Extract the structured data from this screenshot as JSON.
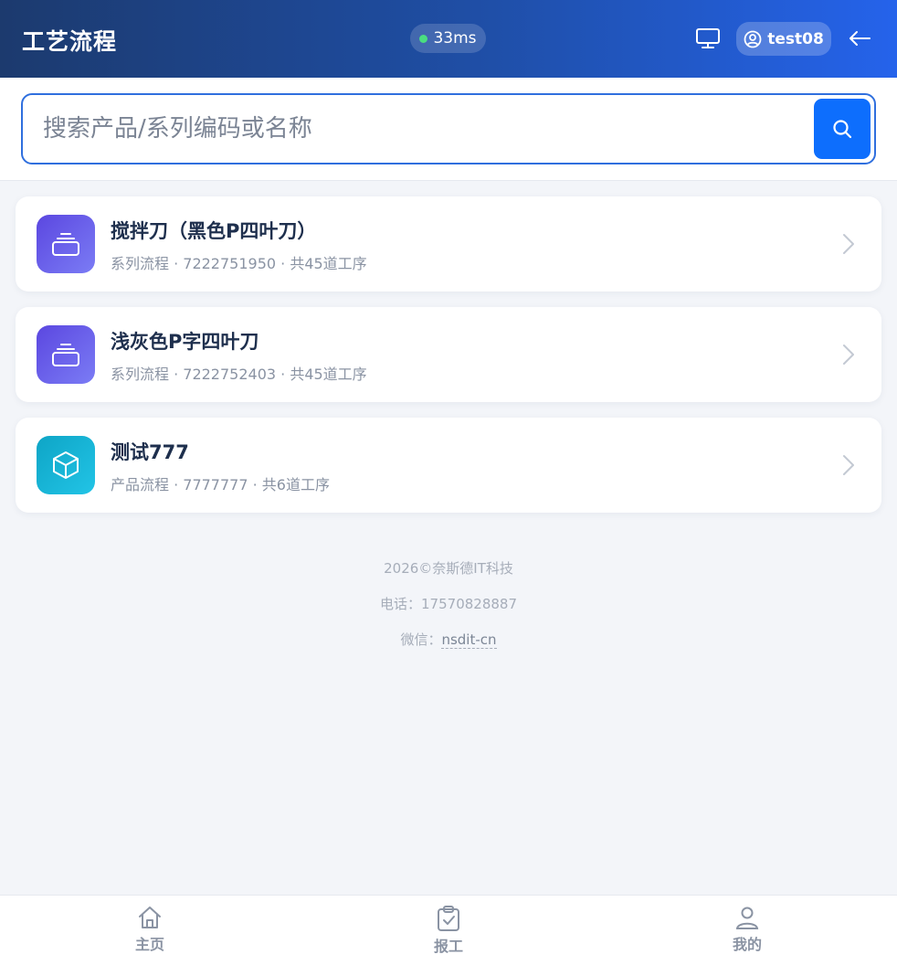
{
  "header": {
    "title": "工艺流程",
    "latency": "33ms",
    "username": "test08"
  },
  "search": {
    "placeholder": "搜索产品/系列编码或名称",
    "value": ""
  },
  "items": [
    {
      "title": "搅拌刀（黑色P四叶刀）",
      "subtitle": "系列流程 · 7222751950 · 共45道工序",
      "icon": "layers-icon"
    },
    {
      "title": "浅灰色P字四叶刀",
      "subtitle": "系列流程 · 7222752403 · 共45道工序",
      "icon": "layers-icon"
    },
    {
      "title": "测试777",
      "subtitle": "产品流程 · 7777777 · 共6道工序",
      "icon": "cube-icon"
    }
  ],
  "footer": {
    "copyright": "2026©奈斯德IT科技",
    "phone_label": "电话：",
    "phone": "17570828887",
    "wechat_label": "微信：",
    "wechat": "nsdit-cn"
  },
  "nav": [
    {
      "label": "主页",
      "icon": "home-icon"
    },
    {
      "label": "报工",
      "icon": "clipboard-check-icon"
    },
    {
      "label": "我的",
      "icon": "user-icon"
    }
  ],
  "colors": {
    "accent": "#0d6efd",
    "header_start": "#1c3a6e",
    "header_end": "#2563eb",
    "status_online": "#4ade80"
  }
}
